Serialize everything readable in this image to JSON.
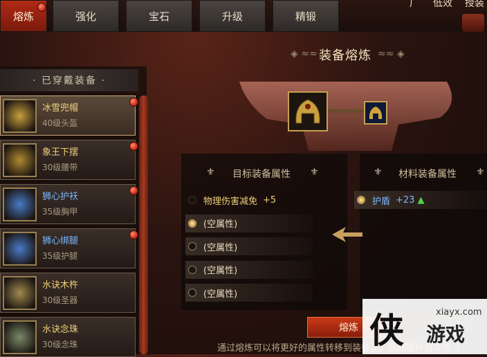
{
  "tabs": [
    {
      "label": "熔炼",
      "active": true
    },
    {
      "label": "强化",
      "active": false
    },
    {
      "label": "宝石",
      "active": false
    },
    {
      "label": "升级",
      "active": false
    },
    {
      "label": "精锻",
      "active": false
    }
  ],
  "topright": [
    "广",
    "低效",
    "授装"
  ],
  "left": {
    "title": "· 已穿戴装备 ·",
    "items": [
      {
        "name": "冰雪兜帽",
        "sub": "40级头盔",
        "name_color": "#f0d07a",
        "icon": "helmet-icon",
        "selected": true
      },
      {
        "name": "象王下摆",
        "sub": "30级腰带",
        "name_color": "#f0d07a",
        "icon": "belt-icon",
        "selected": false
      },
      {
        "name": "狮心护袄",
        "sub": "35级胸甲",
        "name_color": "#7ab8ff",
        "icon": "chest-armor-icon",
        "selected": false
      },
      {
        "name": "狮心绑腿",
        "sub": "35级护腿",
        "name_color": "#7ab8ff",
        "icon": "leg-armor-icon",
        "selected": false
      },
      {
        "name": "水诀木杵",
        "sub": "30级圣器",
        "name_color": "#f0d07a",
        "icon": "pestle-icon",
        "selected": false
      },
      {
        "name": "水诀念珠",
        "sub": "30级念珠",
        "name_color": "#f0d07a",
        "icon": "prayer-beads-icon",
        "selected": false
      }
    ]
  },
  "center": {
    "title": "装备熔炼",
    "target_header": "目标装备属性",
    "material_header": "材料装备属性",
    "target_rows": [
      {
        "text": "物理伤害减免",
        "bonus": "+5",
        "radio": "none"
      },
      {
        "text": "(空属性)",
        "bonus": "",
        "radio": "on"
      },
      {
        "text": "(空属性)",
        "bonus": "",
        "radio": "off"
      },
      {
        "text": "(空属性)",
        "bonus": "",
        "radio": "off"
      },
      {
        "text": "(空属性)",
        "bonus": "",
        "radio": "off"
      }
    ],
    "material_rows": [
      {
        "text": "护盾",
        "bonus": "+23",
        "radio": "on"
      }
    ],
    "smelt_button": "熔炼",
    "description": "通过熔炼可以将更好的属性转移到装备上，从而提升战斗力（"
  },
  "watermark": {
    "site": "xiayx.com",
    "text": "游戏",
    "logo": "侠"
  },
  "colors": {
    "accent": "#c83a18",
    "gold": "#f0d07a",
    "blue": "#7ab8ff",
    "green": "#58d048"
  }
}
